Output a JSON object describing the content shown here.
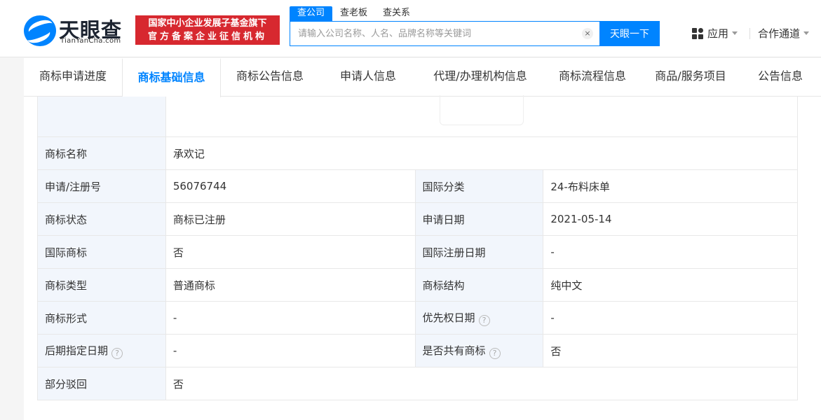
{
  "header": {
    "logo_text": "天眼查",
    "logo_domain": "TianYanCha.com",
    "badge_line1": "国家中小企业发展子基金旗下",
    "badge_line2": "官方备案企业征信机构",
    "search_tabs": [
      "查公司",
      "查老板",
      "查关系"
    ],
    "search_placeholder": "请输入公司名称、人名、品牌名称等关键词",
    "search_button": "天眼一下",
    "apps_label": "应用",
    "partner_label": "合作通道"
  },
  "nav": {
    "tabs": [
      "商标申请进度",
      "商标基础信息",
      "商标公告信息",
      "申请人信息",
      "代理/办理机构信息",
      "商标流程信息",
      "商品/服务项目",
      "公告信息"
    ],
    "active_index": 1
  },
  "info": {
    "name_key": "商标名称",
    "name_val": "承欢记",
    "reg_no_key": "申请/注册号",
    "reg_no_val": "56076744",
    "intl_class_key": "国际分类",
    "intl_class_val": "24-布料床单",
    "status_key": "商标状态",
    "status_val": "商标已注册",
    "apply_date_key": "申请日期",
    "apply_date_val": "2021-05-14",
    "intl_mark_key": "国际商标",
    "intl_mark_val": "否",
    "intl_reg_date_key": "国际注册日期",
    "intl_reg_date_val": "-",
    "type_key": "商标类型",
    "type_val": "普通商标",
    "structure_key": "商标结构",
    "structure_val": "纯中文",
    "form_key": "商标形式",
    "form_val": "-",
    "priority_date_key": "优先权日期",
    "priority_date_val": "-",
    "later_date_key": "后期指定日期",
    "later_date_val": "-",
    "shared_key": "是否共有商标",
    "shared_val": "否",
    "partial_reject_key": "部分驳回",
    "partial_reject_val": "否"
  },
  "icons": {
    "help": "?",
    "clear": "×"
  },
  "colors": {
    "brand": "#0084ff",
    "badge": "#d7282f",
    "key_cell_bg": "#f2f6fc"
  }
}
